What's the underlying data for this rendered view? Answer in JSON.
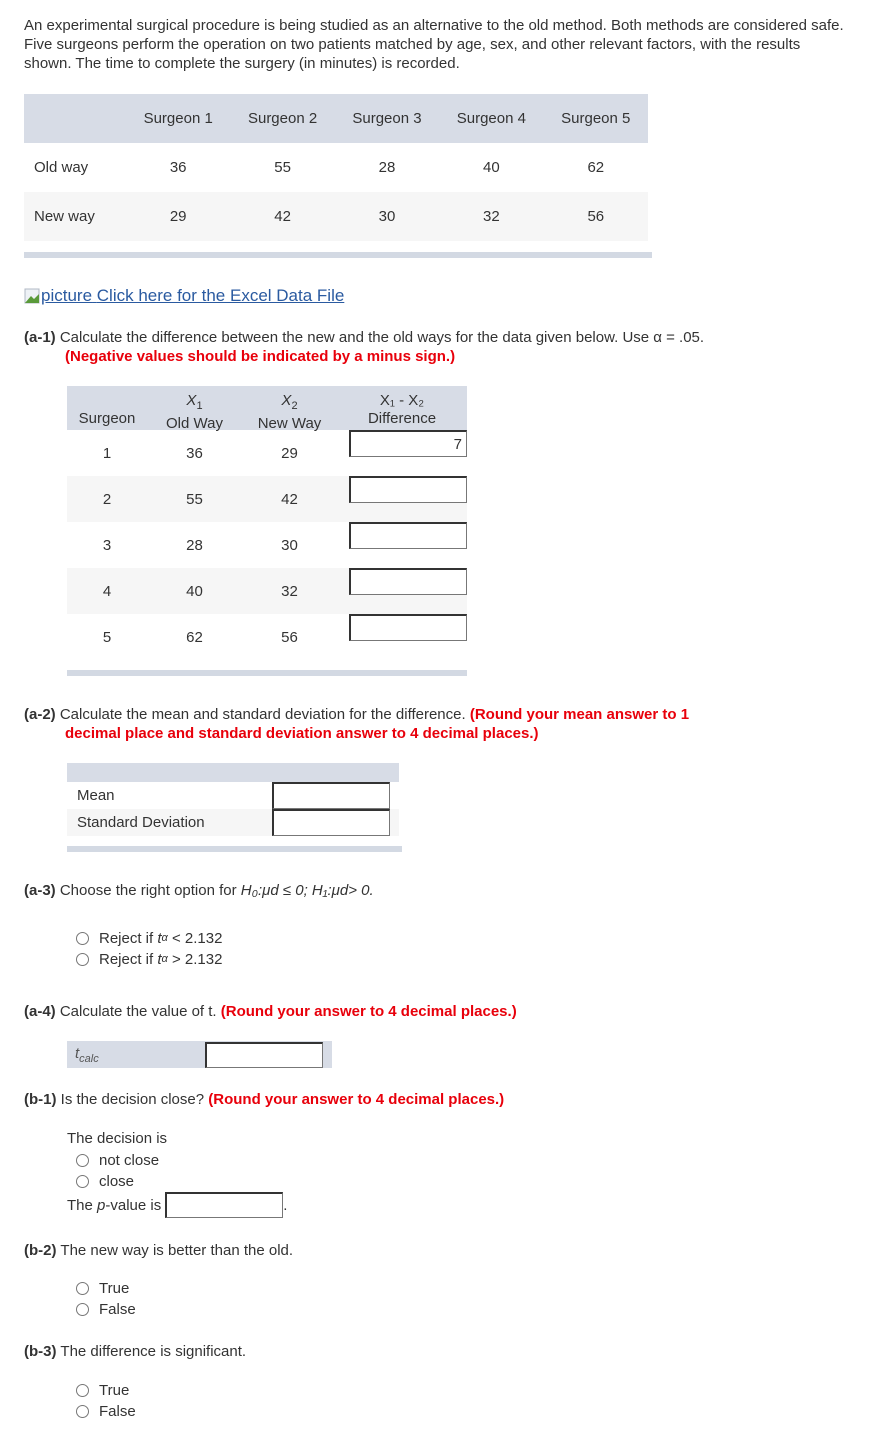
{
  "intro": "An experimental surgical procedure is being studied as an alternative to the old method. Both methods are considered safe. Five surgeons perform the operation on two patients matched by age, sex, and other relevant factors, with the results shown. The time to complete the surgery (in minutes) is recorded.",
  "data_table": {
    "headers": [
      "",
      "Surgeon 1",
      "Surgeon 2",
      "Surgeon 3",
      "Surgeon 4",
      "Surgeon 5"
    ],
    "rows": [
      {
        "label": "Old way",
        "values": [
          "36",
          "55",
          "28",
          "40",
          "62"
        ]
      },
      {
        "label": "New way",
        "values": [
          "29",
          "42",
          "30",
          "32",
          "56"
        ]
      }
    ]
  },
  "excel_link": {
    "alt": "picture",
    "text": "Click here for the Excel Data File"
  },
  "a1": {
    "label": "(a-1)",
    "text": "Calculate the difference between the new and the old ways for the data given below. Use α = .05.",
    "note": "(Negative values should be indicated by a minus sign.)",
    "table": {
      "headers": [
        {
          "sym": "",
          "name": "Surgeon"
        },
        {
          "sym": "X",
          "sub": "1",
          "name": "Old Way"
        },
        {
          "sym": "X",
          "sub": "2",
          "name": "New Way"
        },
        {
          "sym": "X₁ - X₂",
          "name": "Difference"
        }
      ],
      "rows": [
        {
          "surgeon": "1",
          "old": "36",
          "new": "29",
          "diff": "7"
        },
        {
          "surgeon": "2",
          "old": "55",
          "new": "42",
          "diff": ""
        },
        {
          "surgeon": "3",
          "old": "28",
          "new": "30",
          "diff": ""
        },
        {
          "surgeon": "4",
          "old": "40",
          "new": "32",
          "diff": ""
        },
        {
          "surgeon": "5",
          "old": "62",
          "new": "56",
          "diff": ""
        }
      ]
    }
  },
  "a2": {
    "label": "(a-2)",
    "text": "Calculate the mean and standard deviation for the difference.",
    "note_line1": "(Round your mean answer to 1",
    "note_line2": "decimal place and standard deviation answer to 4 decimal places.)",
    "rows": [
      {
        "label": "Mean",
        "value": ""
      },
      {
        "label": "Standard Deviation",
        "value": ""
      }
    ]
  },
  "a3": {
    "label": "(a-3)",
    "text": "Choose the right option for",
    "hypothesis": "H₀:μd ≤ 0; H₁:μd> 0.",
    "options": [
      {
        "prefix": "Reject if",
        "var": "t",
        "sub": "α",
        "rest": "< 2.132",
        "selected": false
      },
      {
        "prefix": "Reject if",
        "var": "t",
        "sub": "α",
        "rest": "> 2.132",
        "selected": false
      }
    ]
  },
  "a4": {
    "label": "(a-4)",
    "text": "Calculate the value of t.",
    "note": "(Round your answer to 4 decimal places.)",
    "field_label": "t",
    "field_sub": "calc",
    "value": ""
  },
  "b1": {
    "label": "(b-1)",
    "text": "Is the decision close?",
    "note": "(Round your answer to 4 decimal places.)",
    "decision_label": "The decision is",
    "options": [
      {
        "label": "not close",
        "selected": false
      },
      {
        "label": "close",
        "selected": false
      }
    ],
    "pvalue_prefix": "The",
    "pvalue_var": "p",
    "pvalue_suffix": "-value is",
    "pvalue": "",
    "period": "."
  },
  "b2": {
    "label": "(b-2)",
    "text": "The new way is better than the old.",
    "options": [
      {
        "label": "True",
        "selected": false
      },
      {
        "label": "False",
        "selected": false
      }
    ]
  },
  "b3": {
    "label": "(b-3)",
    "text": "The difference is significant.",
    "options": [
      {
        "label": "True",
        "selected": false
      },
      {
        "label": "False",
        "selected": false
      }
    ]
  }
}
